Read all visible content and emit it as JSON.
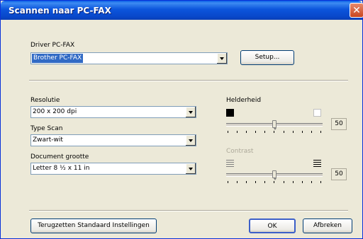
{
  "window": {
    "title": "Scannen naar PC-FAX",
    "close_icon": "close-icon"
  },
  "driver": {
    "label": "Driver PC-FAX",
    "selected": "Brother PC-FAX",
    "setup_button": "Setup..."
  },
  "resolution": {
    "label": "Resolutie",
    "selected": "200 x 200 dpi"
  },
  "scan_type": {
    "label": "Type Scan",
    "selected": "Zwart-wit"
  },
  "document_size": {
    "label": "Document grootte",
    "selected": "Letter 8 ½ x 11 in"
  },
  "brightness": {
    "label": "Helderheid",
    "value": "50",
    "level_percent": 50,
    "min_icon": "black-square-icon",
    "max_icon": "white-square-icon"
  },
  "contrast": {
    "label": "Contrast",
    "value": "50",
    "level_percent": 50,
    "enabled": false,
    "min_icon": "low-contrast-icon",
    "max_icon": "high-contrast-icon"
  },
  "footer": {
    "reset_button": "Terugzetten Standaard Instellingen",
    "ok_button": "OK",
    "cancel_button": "Afbreken"
  },
  "colors": {
    "title_bar": "#0a5ee6",
    "dialog_bg": "#ece9d8",
    "selection": "#316ac5"
  }
}
